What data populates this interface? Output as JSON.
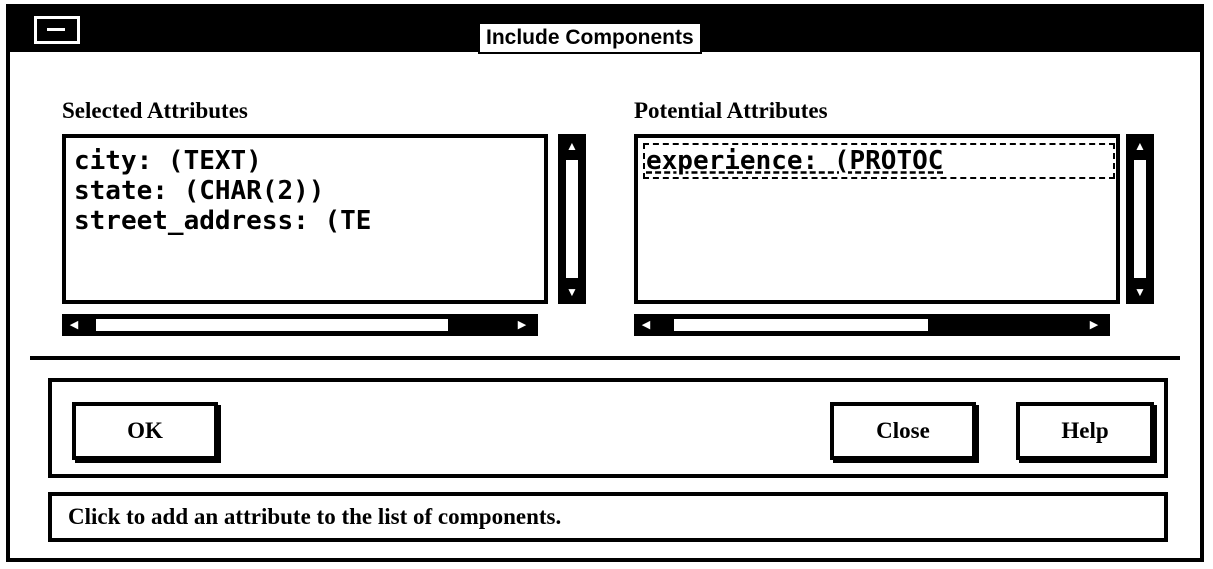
{
  "window": {
    "title": "Include Components"
  },
  "selected": {
    "label": "Selected Attributes",
    "items": [
      "city: (TEXT)",
      "state: (CHAR(2))",
      "street_address: (TE"
    ]
  },
  "potential": {
    "label": "Potential Attributes",
    "items": [
      "experience: (PROTOC"
    ]
  },
  "buttons": {
    "ok": "OK",
    "close": "Close",
    "help": "Help"
  },
  "status": "Click to add an attribute to the list of components.",
  "icons": {
    "menu": "window-menu-icon",
    "scroll_up": "arrow-up-icon",
    "scroll_down": "arrow-down-icon",
    "scroll_left": "arrow-left-icon",
    "scroll_right": "arrow-right-icon"
  }
}
